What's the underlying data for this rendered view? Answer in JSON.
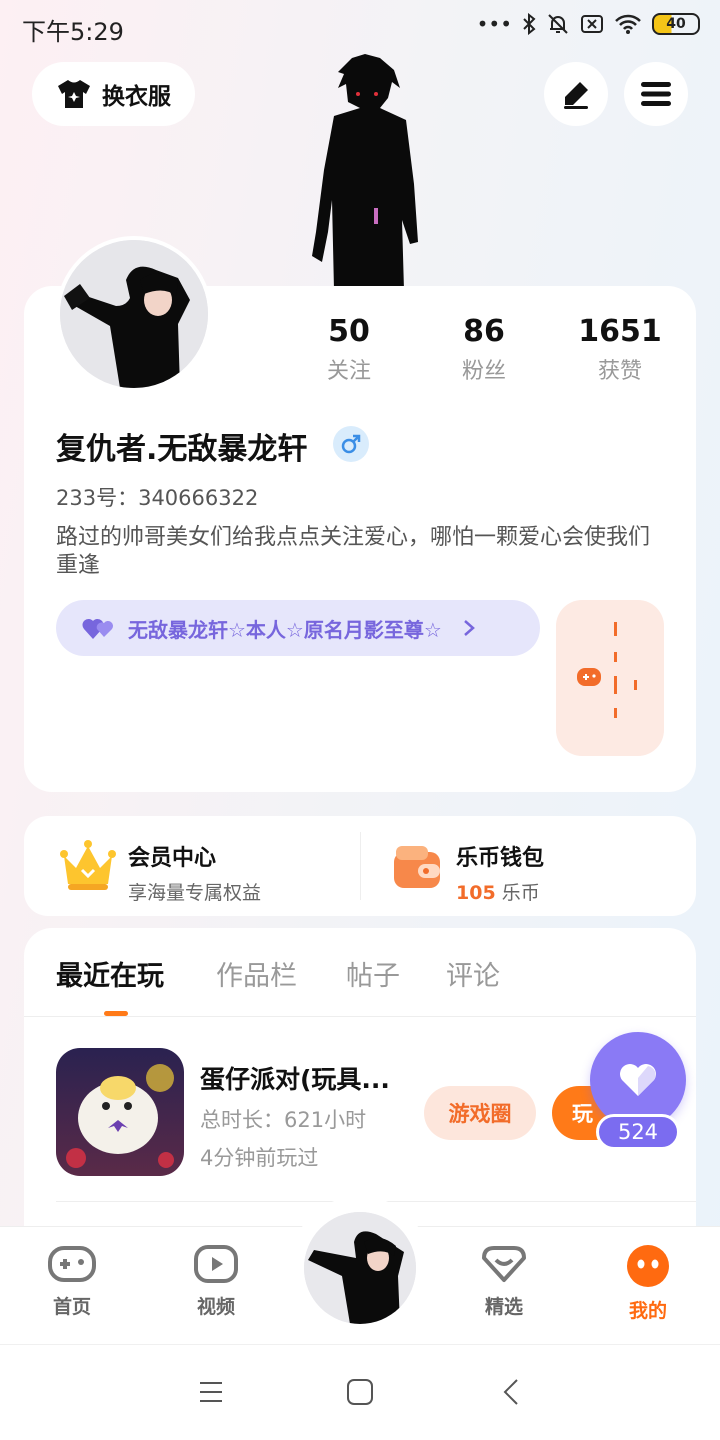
{
  "status_bar": {
    "time": "下午5:29",
    "dots": "•••",
    "battery": "40"
  },
  "top": {
    "outfit_label": "换衣服"
  },
  "profile": {
    "stats": [
      {
        "value": "50",
        "label": "关注"
      },
      {
        "value": "86",
        "label": "粉丝"
      },
      {
        "value": "1651",
        "label": "获赞"
      }
    ],
    "username": "复仇者.无敌暴龙轩",
    "uid": "233号：340666322",
    "bio": "路过的帅哥美女们给我点点关注爱心，哪怕一颗爱心会使我们重逢",
    "nameplate": "无敌暴龙轩☆本人☆原名月影至尊☆"
  },
  "vip": {
    "title": "会员中心",
    "subtitle": "享海量专属权益"
  },
  "wallet": {
    "title": "乐币钱包",
    "amount": "105",
    "unit": "乐币"
  },
  "tabs": [
    {
      "label": "最近在玩",
      "active": true
    },
    {
      "label": "作品栏",
      "active": false
    },
    {
      "label": "帖子",
      "active": false
    },
    {
      "label": "评论",
      "active": false
    }
  ],
  "game": {
    "title": "蛋仔派对(玩具...",
    "duration": "总时长：621小时",
    "last_played": "4分钟前玩过",
    "circle_label": "游戏圈",
    "play_label": "玩"
  },
  "like_float": {
    "count": "524"
  },
  "nav": [
    {
      "label": "首页",
      "icon": "gamepad-icon",
      "active": false
    },
    {
      "label": "视频",
      "icon": "video-icon",
      "active": false
    },
    {
      "label": "精选",
      "icon": "heart-box-icon",
      "active": false
    },
    {
      "label": "我的",
      "icon": "face-icon",
      "active": true
    }
  ],
  "colors": {
    "accent": "#ff7a18",
    "purple": "#8a7af5",
    "nameplate_text": "#7766dd"
  }
}
